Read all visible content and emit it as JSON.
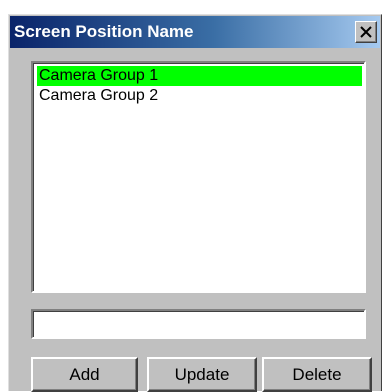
{
  "window": {
    "title": "Screen Position Name"
  },
  "list": {
    "items": [
      {
        "label": "Camera Group 1",
        "selected": true
      },
      {
        "label": "Camera Group 2",
        "selected": false
      }
    ],
    "selection_color": "#00ff00"
  },
  "name_input": {
    "value": "",
    "placeholder": ""
  },
  "buttons": {
    "add_label": "Add",
    "update_label": "Update",
    "delete_label": "Delete"
  },
  "icons": {
    "close": "close-icon"
  },
  "colors": {
    "title_bar_start": "#0a246a",
    "title_bar_end": "#a6caf0",
    "dialog_face": "#c0c0c0"
  }
}
